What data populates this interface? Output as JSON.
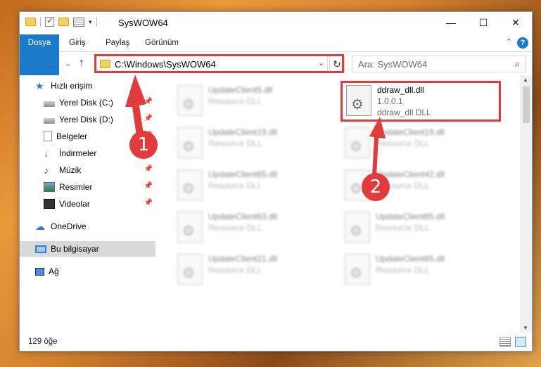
{
  "window": {
    "title": "SysWOW64",
    "minimize_glyph": "—",
    "maximize_glyph": "☐",
    "close_glyph": "✕"
  },
  "ribbon": {
    "tabs": [
      "Dosya",
      "Giriş",
      "Paylaş",
      "Görünüm"
    ],
    "help": "?",
    "collapse_glyph": "⌃"
  },
  "navigation": {
    "back": "←",
    "forward": "→",
    "recent": "⌄",
    "up": "↑",
    "address": "C:\\Windows\\SysWOW64",
    "address_dropdown": "⌄",
    "refresh": "↻",
    "search_placeholder": "Ara: SysWOW64",
    "search_glyph": "⌕"
  },
  "sidebar": {
    "items": [
      {
        "label": "Hızlı erişim",
        "icon": "star-icon",
        "pinned": false
      },
      {
        "label": "Yerel Disk (C:)",
        "icon": "drive-icon",
        "pinned": true
      },
      {
        "label": "Yerel Disk (D:)",
        "icon": "drive-icon",
        "pinned": true
      },
      {
        "label": "Belgeler",
        "icon": "document-icon",
        "pinned": true
      },
      {
        "label": "İndirmeler",
        "icon": "download-icon",
        "pinned": true
      },
      {
        "label": "Müzik",
        "icon": "music-icon",
        "pinned": true
      },
      {
        "label": "Resimler",
        "icon": "pictures-icon",
        "pinned": true
      },
      {
        "label": "Videolar",
        "icon": "videos-icon",
        "pinned": true
      },
      {
        "label": "OneDrive",
        "icon": "cloud-icon",
        "pinned": false
      },
      {
        "label": "Bu bilgisayar",
        "icon": "computer-icon",
        "pinned": false,
        "selected": true
      },
      {
        "label": "Ağ",
        "icon": "network-icon",
        "pinned": false
      }
    ],
    "pin_glyph": "📌"
  },
  "files": {
    "left_column": [
      {
        "name": "UpdateClient5.dll",
        "type": "Resource DLL"
      },
      {
        "name": "UpdateClient19.dll",
        "type": "Resource DLL"
      },
      {
        "name": "UpdateClient65.dll",
        "type": "Resource DLL"
      },
      {
        "name": "UpdateClient63.dll",
        "type": "Resource DLL"
      },
      {
        "name": "UpdateClient21.dll",
        "type": "Resource DLL"
      }
    ],
    "highlighted": {
      "name": "ddraw_dll.dll",
      "version": "1.0.0.1",
      "type": "ddraw_dll DLL"
    },
    "right_column": [
      {
        "name": "UpdateClient19.dll",
        "type": "Resource DLL"
      },
      {
        "name": "UpdateClient42.dll",
        "type": "Resource DLL"
      },
      {
        "name": "UpdateClient65.dll",
        "type": "Resource DLL"
      },
      {
        "name": "UpdateClient65.dll",
        "type": "Resource DLL"
      }
    ]
  },
  "status": {
    "item_count": "129 öğe"
  },
  "annotations": {
    "callout1": "1",
    "callout2": "2",
    "color": "#e23b3b"
  }
}
